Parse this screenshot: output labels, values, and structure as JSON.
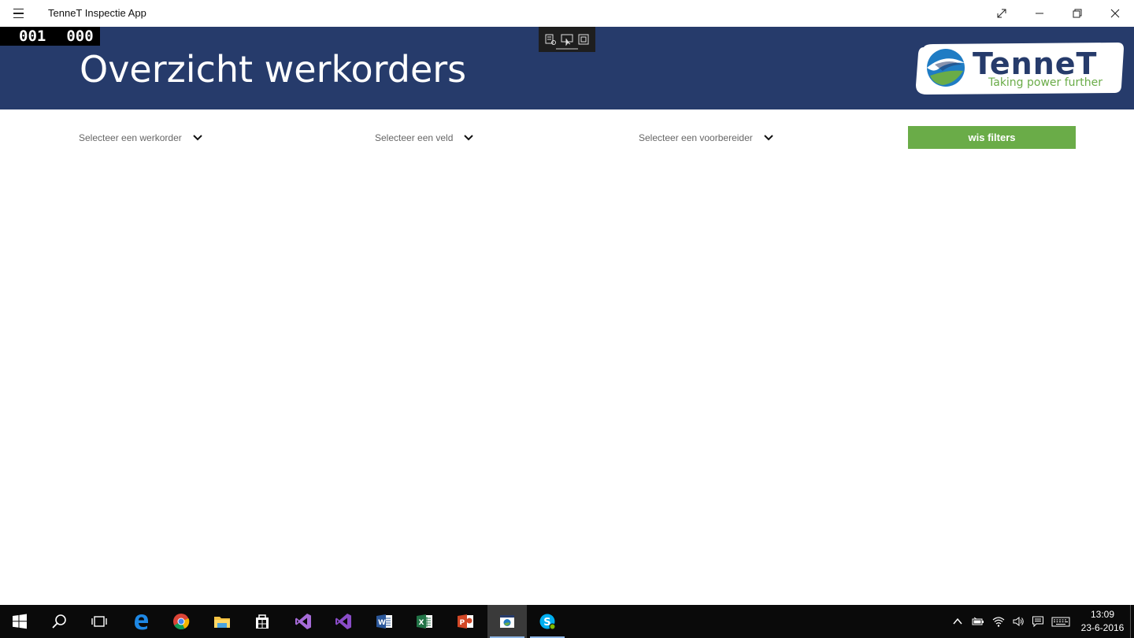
{
  "window": {
    "title": "TenneT Inspectie App"
  },
  "debug_counter": {
    "left": "001",
    "right": "000"
  },
  "header": {
    "page_title": "Overzicht werkorders",
    "logo": {
      "brand": "TenneT",
      "tagline": "Taking power further",
      "colors": {
        "navy": "#263b6b",
        "green": "#6aac48",
        "blue": "#1f8bc9"
      }
    }
  },
  "filters": {
    "werkorder_placeholder": "Selecteer een werkorder",
    "veld_placeholder": "Selecteer een veld",
    "voorbereider_placeholder": "Selecteer een voorbereider",
    "clear_label": "wis filters"
  },
  "taskbar": {
    "apps": [
      {
        "icon": "windows-start-icon"
      },
      {
        "icon": "search-icon"
      },
      {
        "icon": "task-view-icon"
      },
      {
        "icon": "edge-icon"
      },
      {
        "icon": "chrome-icon"
      },
      {
        "icon": "file-explorer-icon"
      },
      {
        "icon": "store-icon"
      },
      {
        "icon": "visual-studio-icon"
      },
      {
        "icon": "visual-studio-alt-icon"
      },
      {
        "icon": "word-icon"
      },
      {
        "icon": "excel-icon"
      },
      {
        "icon": "powerpoint-icon"
      },
      {
        "icon": "tennet-app-icon"
      },
      {
        "icon": "skype-icon"
      }
    ],
    "clock": {
      "time": "13:09",
      "date": "23-6-2016"
    }
  },
  "colors": {
    "header_bg": "#263b6b",
    "clear_button": "#6aac48",
    "taskbar_bg": "#0a0a0a"
  }
}
